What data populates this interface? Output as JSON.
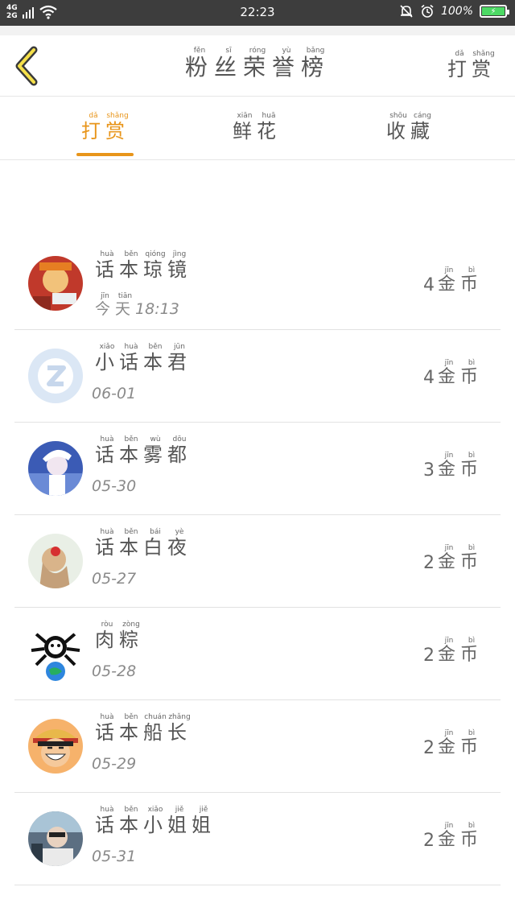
{
  "status_bar": {
    "network_top": "4G",
    "network_bottom": "2G",
    "time": "22:23",
    "battery": "100%"
  },
  "header": {
    "title": [
      {
        "char": "粉",
        "pinyin": "fěn"
      },
      {
        "char": "丝",
        "pinyin": "sī"
      },
      {
        "char": "荣",
        "pinyin": "róng"
      },
      {
        "char": "誉",
        "pinyin": "yù"
      },
      {
        "char": "榜",
        "pinyin": "bǎng"
      }
    ],
    "right_action": [
      {
        "char": "打",
        "pinyin": "dǎ"
      },
      {
        "char": "赏",
        "pinyin": "shǎng"
      }
    ]
  },
  "tabs": [
    {
      "active": true,
      "chars": [
        {
          "char": "打",
          "pinyin": "dǎ"
        },
        {
          "char": "赏",
          "pinyin": "shǎng"
        }
      ]
    },
    {
      "active": false,
      "chars": [
        {
          "char": "鲜",
          "pinyin": "xiān"
        },
        {
          "char": "花",
          "pinyin": "huā"
        }
      ]
    },
    {
      "active": false,
      "chars": [
        {
          "char": "收",
          "pinyin": "shōu"
        },
        {
          "char": "藏",
          "pinyin": "cáng"
        }
      ]
    }
  ],
  "coin_unit": [
    {
      "char": "金",
      "pinyin": "jīn"
    },
    {
      "char": "币",
      "pinyin": "bì"
    }
  ],
  "accent_color": "#e8951a",
  "fans": [
    {
      "name": [
        {
          "char": "话",
          "pinyin": "huà"
        },
        {
          "char": "本",
          "pinyin": "běn"
        },
        {
          "char": "琼",
          "pinyin": "qióng"
        },
        {
          "char": "镜",
          "pinyin": "jìng"
        }
      ],
      "date_chars": [
        {
          "char": "今",
          "pinyin": "jīn"
        },
        {
          "char": "天",
          "pinyin": "tiān"
        }
      ],
      "date": "18:13",
      "coins": "4",
      "avatar": "cartoon-avatar"
    },
    {
      "name": [
        {
          "char": "小",
          "pinyin": "xiǎo"
        },
        {
          "char": "话",
          "pinyin": "huà"
        },
        {
          "char": "本",
          "pinyin": "běn"
        },
        {
          "char": "君",
          "pinyin": "jūn"
        }
      ],
      "date_chars": [],
      "date": "06-01",
      "coins": "4",
      "avatar": "default-qq-avatar"
    },
    {
      "name": [
        {
          "char": "话",
          "pinyin": "huà"
        },
        {
          "char": "本",
          "pinyin": "běn"
        },
        {
          "char": "雾",
          "pinyin": "wù"
        },
        {
          "char": "都",
          "pinyin": "dōu"
        }
      ],
      "date_chars": [],
      "date": "05-30",
      "coins": "3",
      "avatar": "anime-avatar"
    },
    {
      "name": [
        {
          "char": "话",
          "pinyin": "huà"
        },
        {
          "char": "本",
          "pinyin": "běn"
        },
        {
          "char": "白",
          "pinyin": "bái"
        },
        {
          "char": "夜",
          "pinyin": "yè"
        }
      ],
      "date_chars": [],
      "date": "05-27",
      "coins": "2",
      "avatar": "photo-avatar"
    },
    {
      "name": [
        {
          "char": "肉",
          "pinyin": "ròu"
        },
        {
          "char": "粽",
          "pinyin": "zòng"
        }
      ],
      "date_chars": [],
      "date": "05-28",
      "coins": "2",
      "avatar": "meme-avatar"
    },
    {
      "name": [
        {
          "char": "话",
          "pinyin": "huà"
        },
        {
          "char": "本",
          "pinyin": "běn"
        },
        {
          "char": "船",
          "pinyin": "chuán"
        },
        {
          "char": "长",
          "pinyin": "zhǎng"
        }
      ],
      "date_chars": [],
      "date": "05-29",
      "coins": "2",
      "avatar": "luffy-avatar"
    },
    {
      "name": [
        {
          "char": "话",
          "pinyin": "huà"
        },
        {
          "char": "本",
          "pinyin": "běn"
        },
        {
          "char": "小",
          "pinyin": "xiǎo"
        },
        {
          "char": "姐",
          "pinyin": "jiě"
        },
        {
          "char": "姐",
          "pinyin": "jiě"
        }
      ],
      "date_chars": [],
      "date": "05-31",
      "coins": "2",
      "avatar": "photo-avatar-2"
    }
  ]
}
